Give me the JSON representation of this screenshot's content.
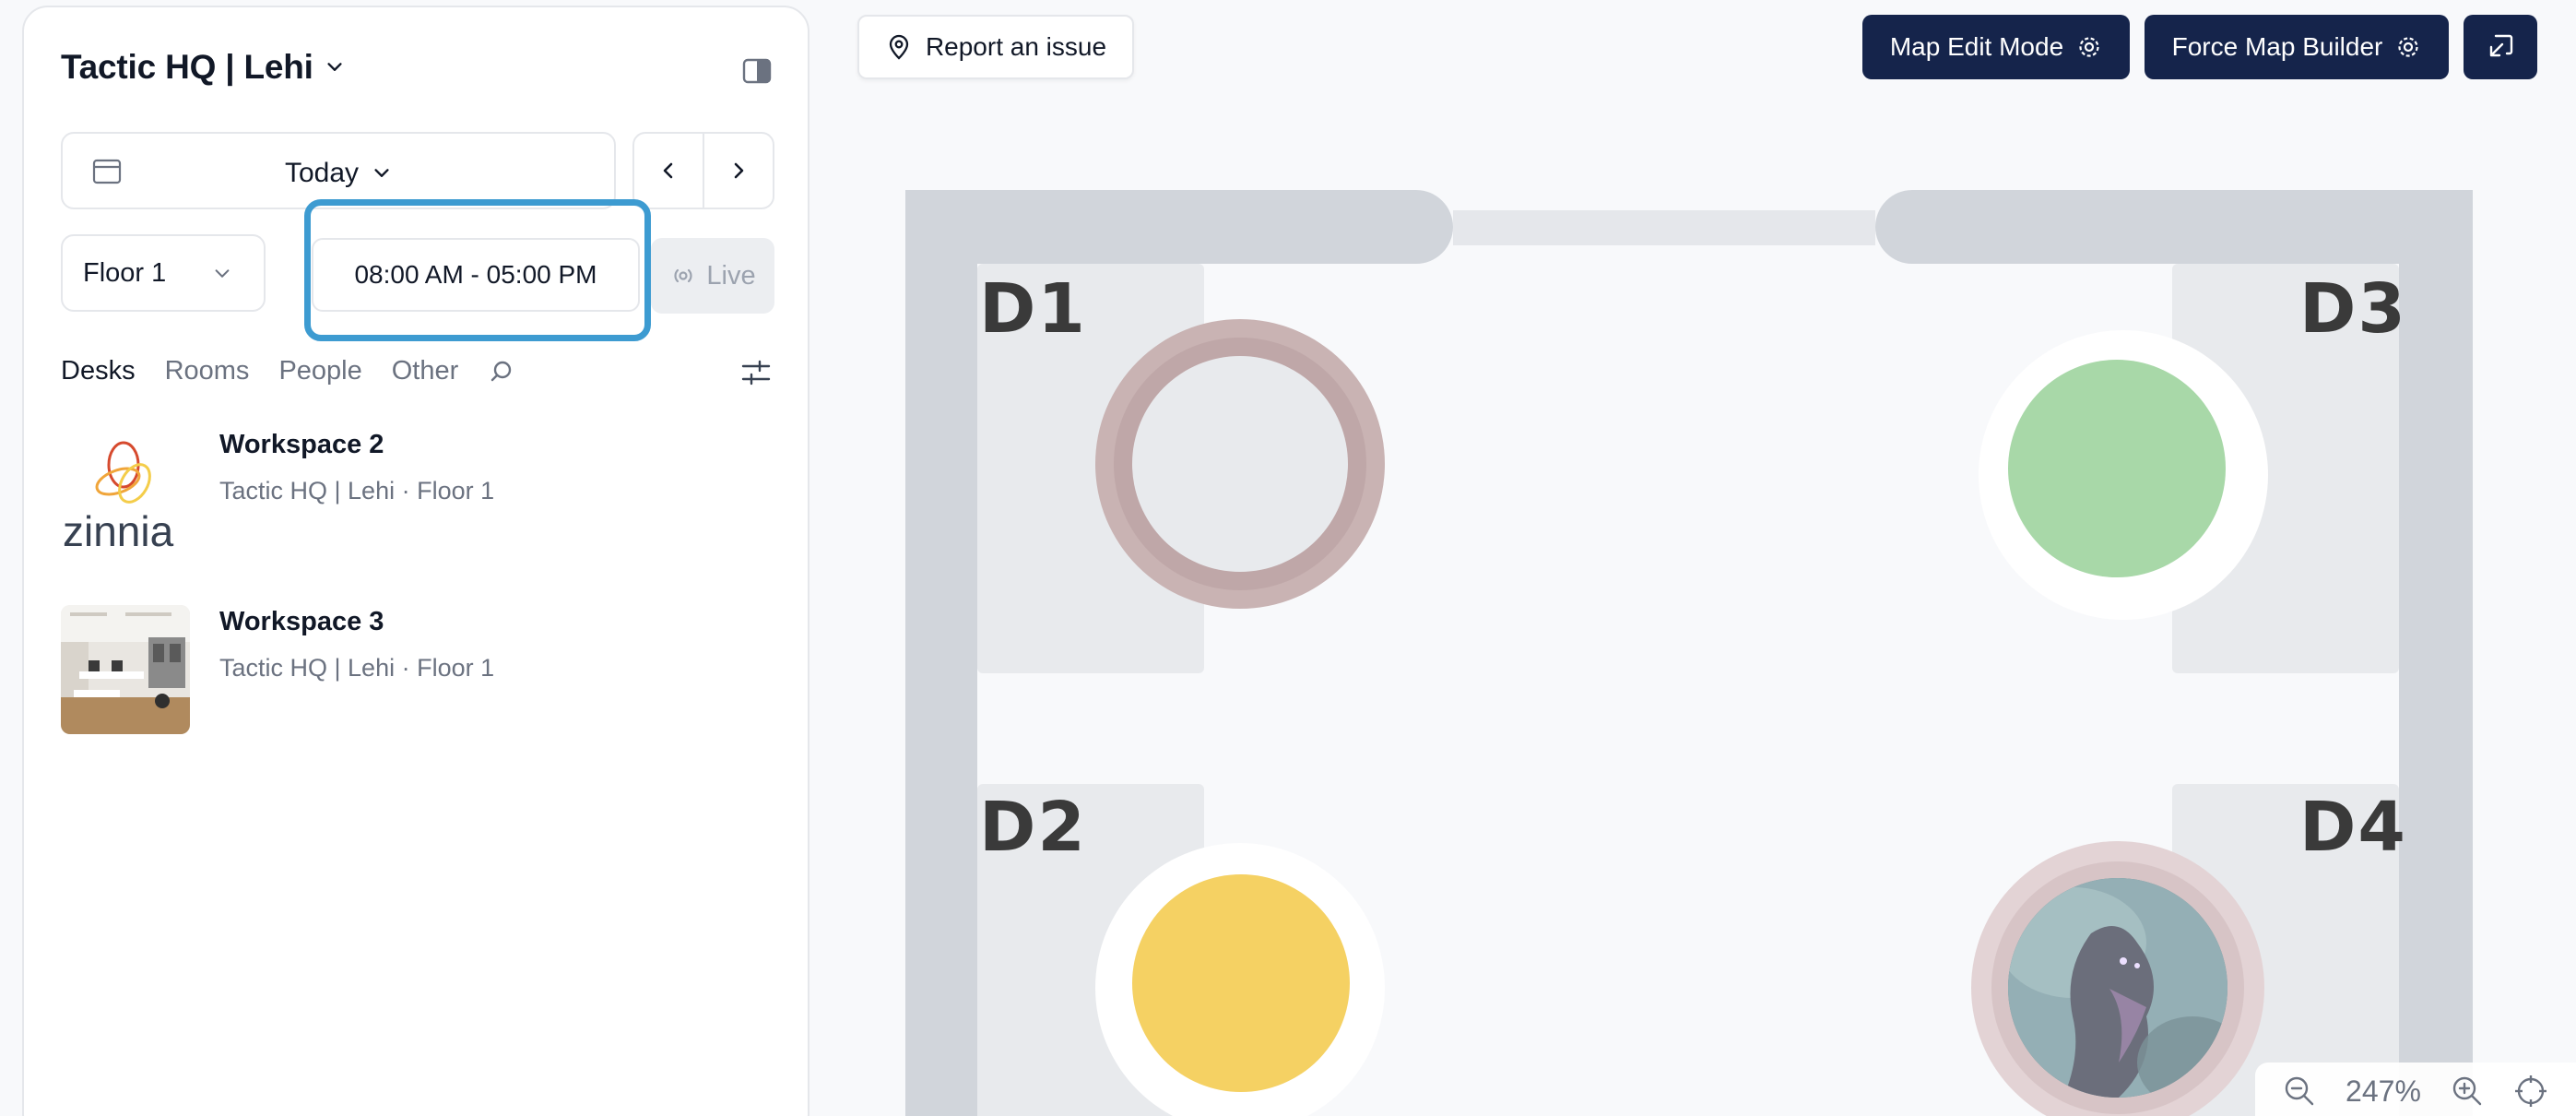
{
  "sidebar": {
    "title": "Tactic HQ | Lehi",
    "date_label": "Today",
    "floor_label": "Floor 1",
    "time_range": "08:00 AM - 05:00 PM",
    "live_label": "Live",
    "tabs": [
      "Desks",
      "Rooms",
      "People",
      "Other"
    ],
    "active_tab": "Desks",
    "items": [
      {
        "name": "Workspace 2",
        "subtitle": "Tactic HQ | Lehi · Floor 1",
        "thumb_text": "zinnia"
      },
      {
        "name": "Workspace 3",
        "subtitle": "Tactic HQ | Lehi · Floor 1"
      }
    ]
  },
  "topbar": {
    "report_label": "Report an issue",
    "map_edit_label": "Map Edit Mode",
    "force_map_label": "Force Map Builder"
  },
  "map": {
    "desks": [
      {
        "label": "D1",
        "status_color": "#c9b3b3"
      },
      {
        "label": "D2",
        "status_color": "#f5d163"
      },
      {
        "label": "D3",
        "status_color": "#a8d8a8"
      },
      {
        "label": "D4",
        "status_color": "#e3d3d5"
      }
    ],
    "zoom_level": "247%"
  },
  "colors": {
    "accent_dark": "#15244b",
    "highlight": "#3d9bd1",
    "wall": "#d1d5db"
  }
}
